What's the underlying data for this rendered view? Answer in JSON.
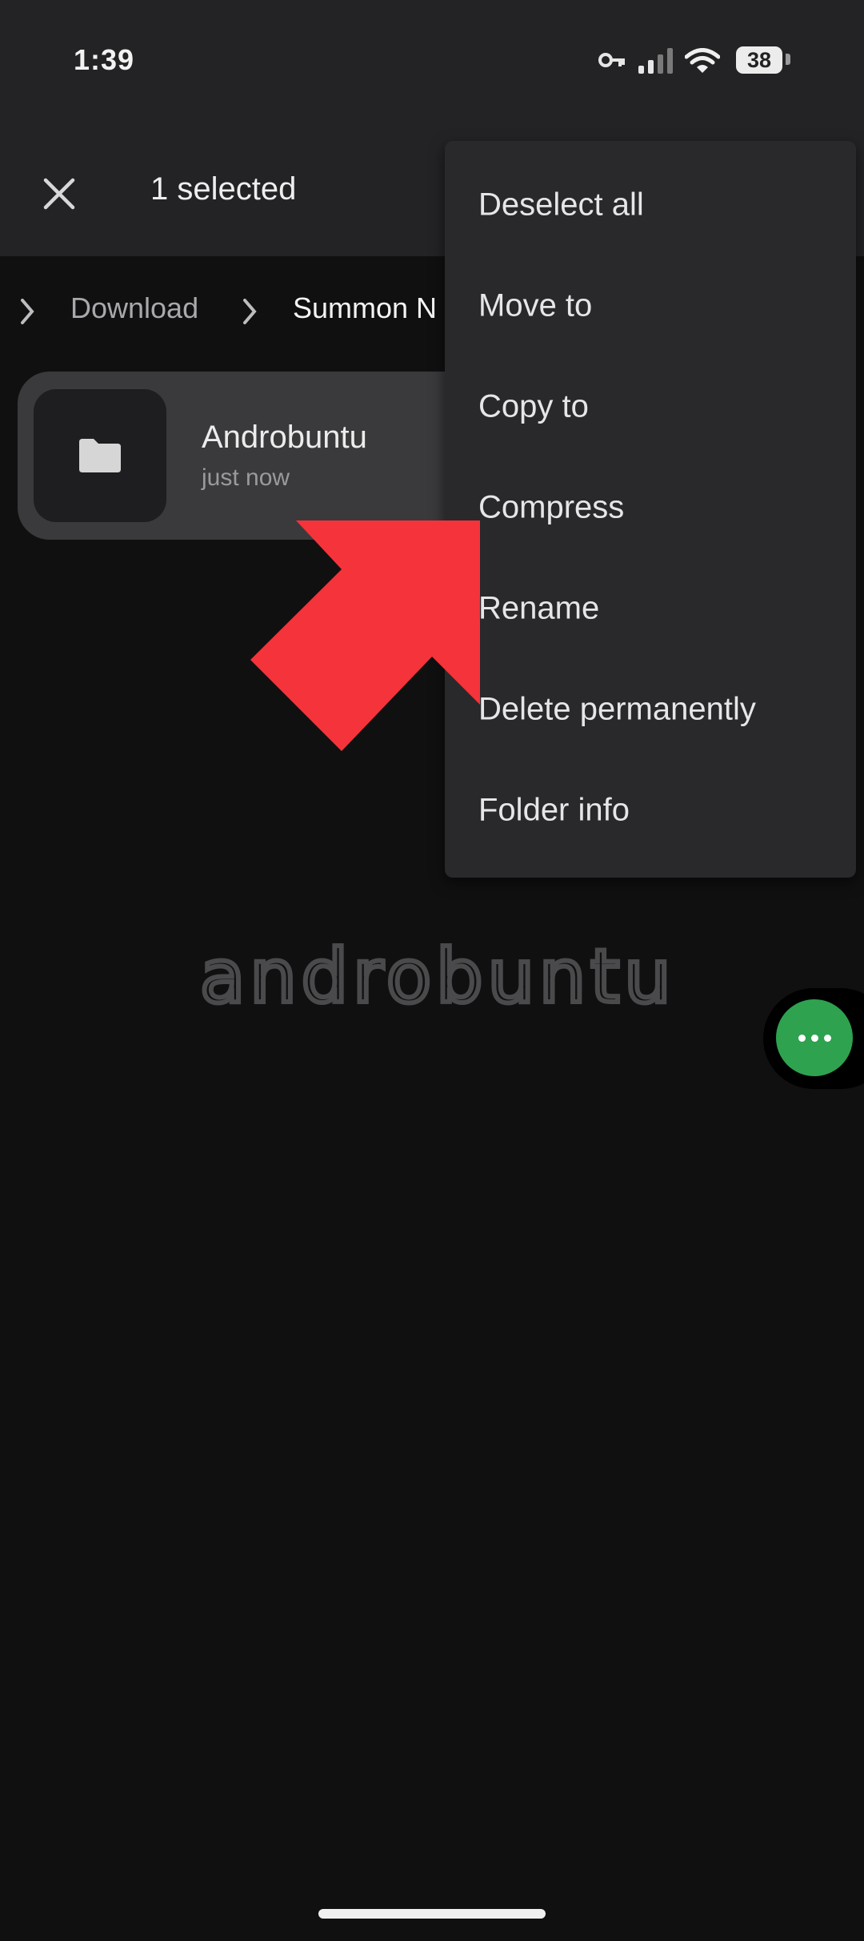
{
  "status_bar": {
    "time": "1:39",
    "battery": "38",
    "icons": [
      "vpn-key-icon",
      "signal-icon",
      "wifi-icon",
      "battery-icon"
    ]
  },
  "app_bar": {
    "title": "1 selected",
    "close_icon": "close-icon"
  },
  "breadcrumb": {
    "items": [
      "Download",
      "Summon N"
    ]
  },
  "file": {
    "name": "Androbuntu",
    "modified": "just now",
    "icon": "folder-icon"
  },
  "context_menu": {
    "items": [
      {
        "label": "Deselect all"
      },
      {
        "label": "Move to"
      },
      {
        "label": "Copy to"
      },
      {
        "label": "Compress"
      },
      {
        "label": "Rename"
      },
      {
        "label": "Delete permanently"
      },
      {
        "label": "Folder info"
      }
    ]
  },
  "watermark": "androbuntu",
  "floating_button": {
    "icon": "more-dots-icon",
    "color": "#2ea24f"
  },
  "annotation": {
    "arrow_color": "#f5333a",
    "points_to": "Compress"
  },
  "colors": {
    "background": "#101011",
    "top_bar": "#232325",
    "menu": "#29292b",
    "card": "#3a3a3c"
  }
}
